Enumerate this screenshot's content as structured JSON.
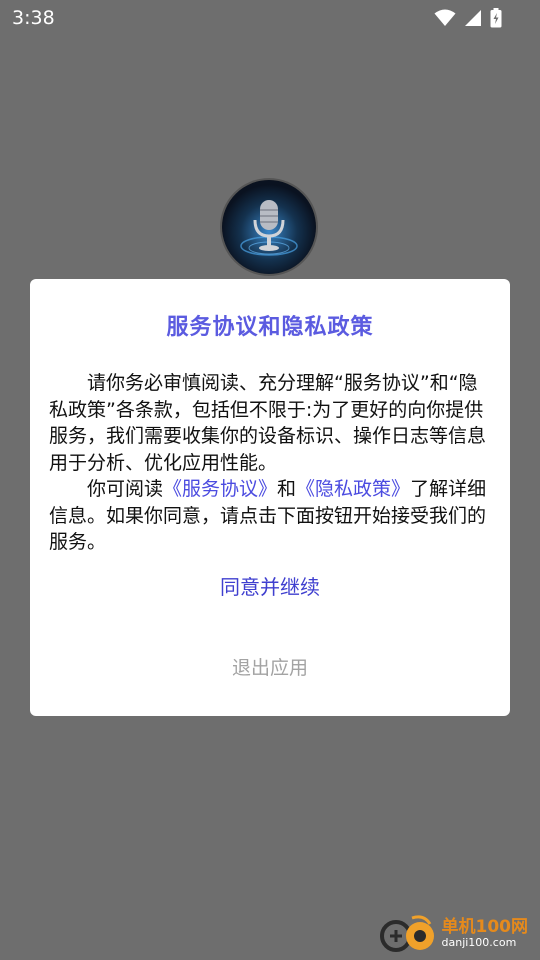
{
  "status_bar": {
    "time": "3:38",
    "icons": [
      "wifi-icon",
      "cellular-signal-icon",
      "battery-charging-icon"
    ]
  },
  "app": {
    "logo_icon": "microphone-icon"
  },
  "dialog": {
    "title": "服务协议和隐私政策",
    "paragraph1": "请你务必审慎阅读、充分理解“服务协议”和“隐私政策”各条款，包括但不限于:为了更好的向你提供服务，我们需要收集你的设备标识、操作日志等信息用于分析、优化应用性能。",
    "paragraph2_prefix": "你可阅读",
    "service_link": "《服务协议》",
    "paragraph2_and": "和",
    "privacy_link": "《隐私政策》",
    "paragraph2_suffix": "了解详细信息。如果你同意，请点击下面按钮开始接受我们的服务。",
    "agree_label": "同意并继续",
    "exit_label": "退出应用"
  },
  "watermark": {
    "name_cn": "单机100网",
    "domain": "danji100.com"
  },
  "colors": {
    "overlay": "#6e6e6e",
    "title": "#5b5be0",
    "link": "#4b4be0",
    "agree": "#3f3fcf",
    "exit": "#a3a3a3"
  }
}
